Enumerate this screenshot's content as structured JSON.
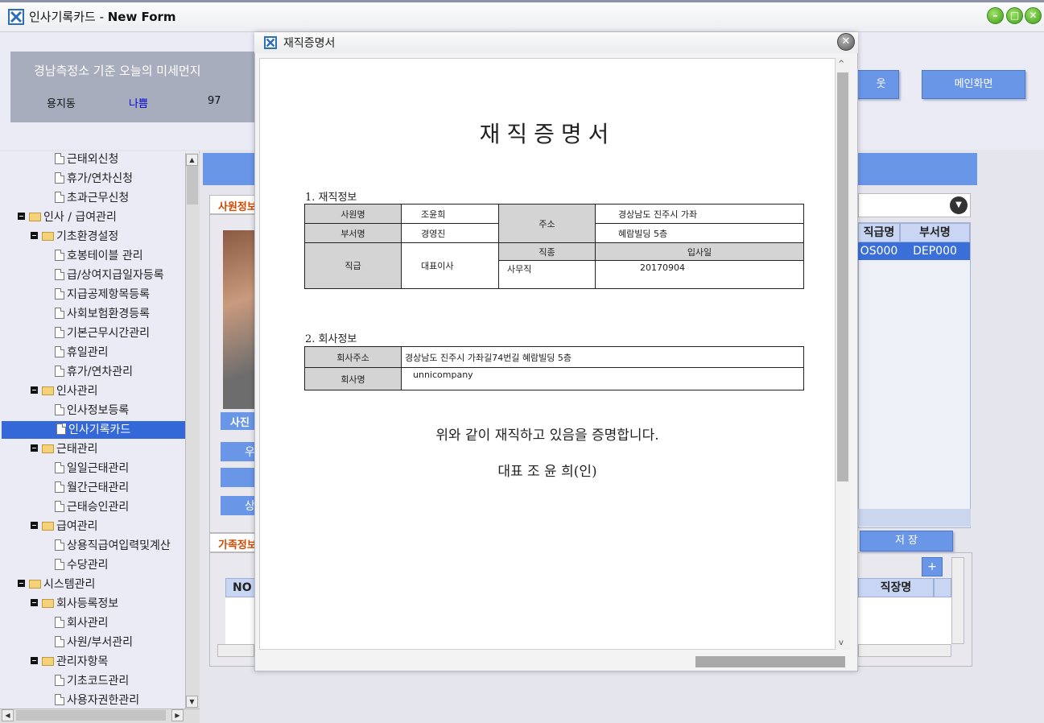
{
  "window": {
    "title": "인사기록카드 - ",
    "title_bold": "New Form"
  },
  "dust": {
    "title": "경남측정소 기준 오늘의 미세먼지",
    "location": "용지동",
    "grade": "나쁨",
    "value": "97"
  },
  "header_buttons": {
    "partial": "웃",
    "main_screen": "메인화면"
  },
  "sidebar": {
    "items": [
      {
        "label": "근태외신청",
        "type": "doc",
        "level": 3
      },
      {
        "label": "휴가/연차신청",
        "type": "doc",
        "level": 3
      },
      {
        "label": "초과근무신청",
        "type": "doc",
        "level": 3
      },
      {
        "label": "인사 / 급여관리",
        "type": "folder",
        "level": 1
      },
      {
        "label": "기초환경설정",
        "type": "folder",
        "level": 2
      },
      {
        "label": "호봉테이블 관리",
        "type": "doc",
        "level": 3
      },
      {
        "label": "급/상여지급일자등록",
        "type": "doc",
        "level": 3
      },
      {
        "label": "지급공제항목등록",
        "type": "doc",
        "level": 3
      },
      {
        "label": "사회보험환경등록",
        "type": "doc",
        "level": 3
      },
      {
        "label": "기본근무시간관리",
        "type": "doc",
        "level": 3
      },
      {
        "label": "휴일관리",
        "type": "doc",
        "level": 3
      },
      {
        "label": "휴가/연차관리",
        "type": "doc",
        "level": 3
      },
      {
        "label": "인사관리",
        "type": "folder",
        "level": 2
      },
      {
        "label": "인사정보등록",
        "type": "doc",
        "level": 3
      },
      {
        "label": "인사기록카드",
        "type": "doc",
        "level": 3,
        "selected": true
      },
      {
        "label": "근태관리",
        "type": "folder",
        "level": 2
      },
      {
        "label": "일일근태관리",
        "type": "doc",
        "level": 3
      },
      {
        "label": "월간근태관리",
        "type": "doc",
        "level": 3
      },
      {
        "label": "근태승인관리",
        "type": "doc",
        "level": 3
      },
      {
        "label": "급여관리",
        "type": "folder",
        "level": 2
      },
      {
        "label": "상용직급여입력및계산",
        "type": "doc",
        "level": 3
      },
      {
        "label": "수당관리",
        "type": "doc",
        "level": 3
      },
      {
        "label": "시스템관리",
        "type": "folder",
        "level": 1
      },
      {
        "label": "회사등록정보",
        "type": "folder",
        "level": 2
      },
      {
        "label": "회사관리",
        "type": "doc",
        "level": 3
      },
      {
        "label": "사원/부서관리",
        "type": "doc",
        "level": 3
      },
      {
        "label": "관리자항목",
        "type": "folder",
        "level": 2
      },
      {
        "label": "기초코드관리",
        "type": "doc",
        "level": 3
      },
      {
        "label": "사용자권한관리",
        "type": "doc",
        "level": 3
      }
    ]
  },
  "background": {
    "employee_tab": "사원정보",
    "photo_button": "사진",
    "family_tab": "가족정보",
    "btn_u": "우",
    "btn_s": "상",
    "grid_col_grade": "직급명",
    "grid_col_dept": "부서명",
    "grid_val_grade": "OS000",
    "grid_val_dept": "DEP000",
    "save_button": "저 장",
    "family_col_no": "NO",
    "family_col_workplace": "직장명",
    "add_button": "+"
  },
  "modal": {
    "title": "재직증명서",
    "close": "✕",
    "heading": "재직증명서",
    "section1": "1. 재직정보",
    "section2": "2. 회사정보",
    "employment": {
      "name_label": "사원명",
      "name": "조윤희",
      "dept_label": "부서명",
      "dept": "경영진",
      "address_label": "주소",
      "address1": "경상남도 진주시  가좌",
      "address2": "혜람빌딩 5층",
      "position_label": "직급",
      "position": "대표이사",
      "job_label": "직종",
      "job": "사무직",
      "join_label": "입사일",
      "join": "20170904"
    },
    "company": {
      "addr_label": "회사주소",
      "addr": "경상남도 진주시 가좌길74번길 혜람빌딩 5층",
      "name_label": "회사명",
      "name": "unnicompany"
    },
    "statement": "위와 같이 재직하고 있음을 증명합니다.",
    "ceo": "대표 조 윤 희(인)"
  }
}
